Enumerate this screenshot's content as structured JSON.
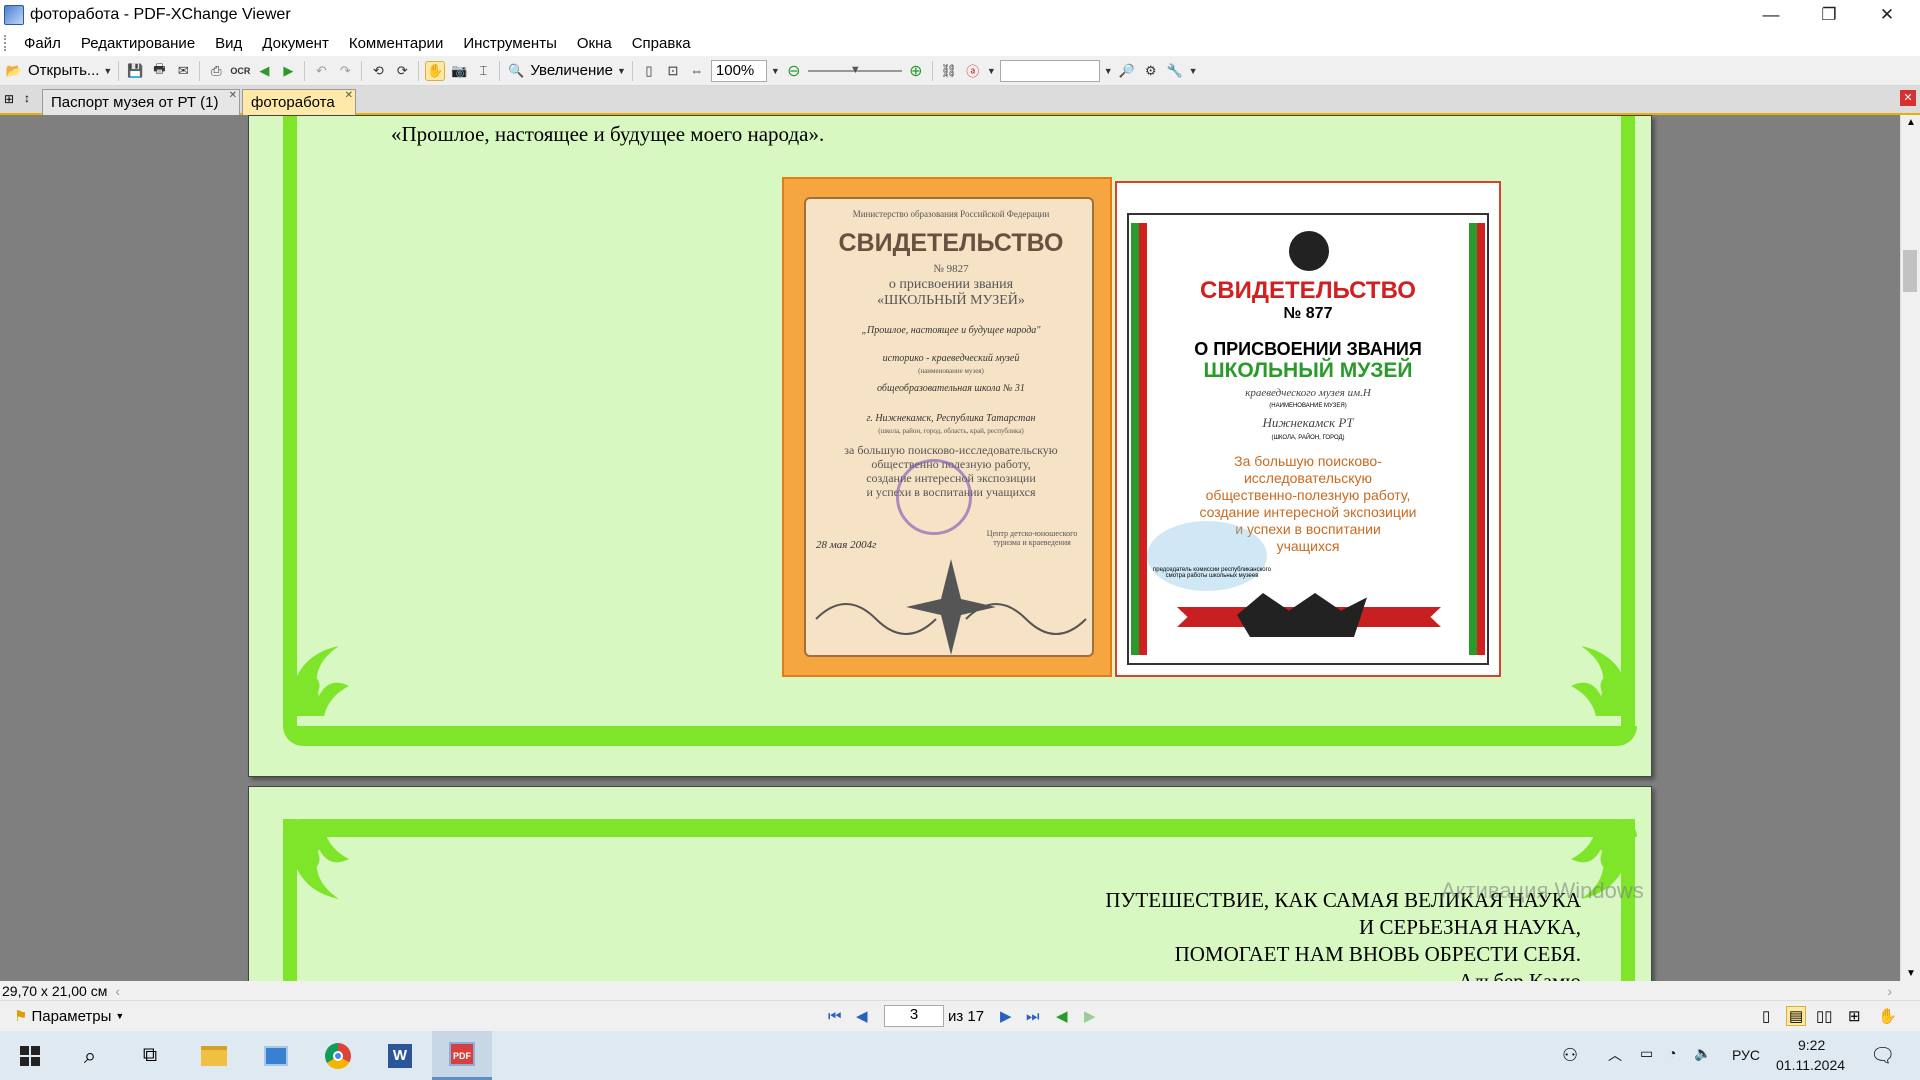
{
  "window": {
    "title": "фоторабота - PDF-XChange Viewer",
    "minimize": "—",
    "restore": "❐",
    "close": "✕"
  },
  "menu": [
    "Файл",
    "Редактирование",
    "Вид",
    "Документ",
    "Комментарии",
    "Инструменты",
    "Окна",
    "Справка"
  ],
  "toolbar": {
    "open_label": "Открыть...",
    "zoom_label": "Увеличение",
    "zoom_value": "100%",
    "search_value": ""
  },
  "tabs": [
    {
      "label": "Паспорт музея от РТ (1)",
      "active": false
    },
    {
      "label": "фоторабота",
      "active": true
    }
  ],
  "document": {
    "page1_caption": "«Прошлое, настоящее и будущее моего народа».",
    "cert_orange": {
      "ministry": "Министерство образования Российской Федерации",
      "title": "СВИДЕТЕЛЬСТВО",
      "number": "№ 9827",
      "line1": "о присвоении звания",
      "line2": "«ШКОЛЬНЫЙ МУЗЕЙ»",
      "museum_name": "„Прошлое, настоящее и будущее народа\"",
      "museum_type": "историко - краеведческий музей",
      "museum_type_hint": "(наименование музея)",
      "school": "общеобразовательная школа № 31",
      "city": "г. Нижнекамск, Республика Татарстан",
      "city_hint": "(школа, район, город, область, край, республика)",
      "reason1": "за большую поисково-исследовательскую",
      "reason2": "общественно полезную работу,",
      "reason3": "создание интересной экспозиции",
      "reason4": "и успехи в воспитании учащихся",
      "date": "28 мая 2004г",
      "issuer": "Центр детско-юношеского туризма и краеведения"
    },
    "cert_white": {
      "title": "СВИДЕТЕЛЬСТВО",
      "number": "№ 877",
      "line1": "О ПРИСВОЕНИИ ЗВАНИЯ",
      "line2": "ШКОЛЬНЫЙ МУЗЕЙ",
      "museum_name": "краеведческого музея им.Н",
      "museum_hint": "(НАИМЕНОВАНИЕ МУЗЕЯ)",
      "place": "Нижнекамск РТ",
      "place_hint": "(ШКОЛА, РАЙОН, ГОРОД)",
      "reason1": "За большую поисково-",
      "reason2": "исследовательскую",
      "reason3": "общественно-полезную работу,",
      "reason4": "создание интересной экспозиции",
      "reason5": "и успехи в воспитании",
      "reason6": "учащихся",
      "footer": "председатель комиссии республиканского смотра работы школьных музеев"
    },
    "quote": [
      "ПУТЕШЕСТВИЕ, КАК САМАЯ ВЕЛИКАЯ НАУКА",
      "И СЕРЬЕЗНАЯ НАУКА,",
      "ПОМОГАЕТ НАМ ВНОВЬ ОБРЕСТИ СЕБЯ.",
      "Альбер Камю"
    ],
    "watermark": "Активация Windows"
  },
  "status": {
    "page_size": "29,70 x 21,00 см",
    "params_label": "Параметры",
    "current_page": "3",
    "of_pages": "из 17"
  },
  "tray": {
    "lang": "РУС",
    "time": "9:22",
    "date": "01.11.2024"
  },
  "colors": {
    "page_bg": "#d8f8c2",
    "frame_green": "#7fe52a",
    "cert_orange": "#f6a640",
    "cert_red": "#cc2020"
  }
}
